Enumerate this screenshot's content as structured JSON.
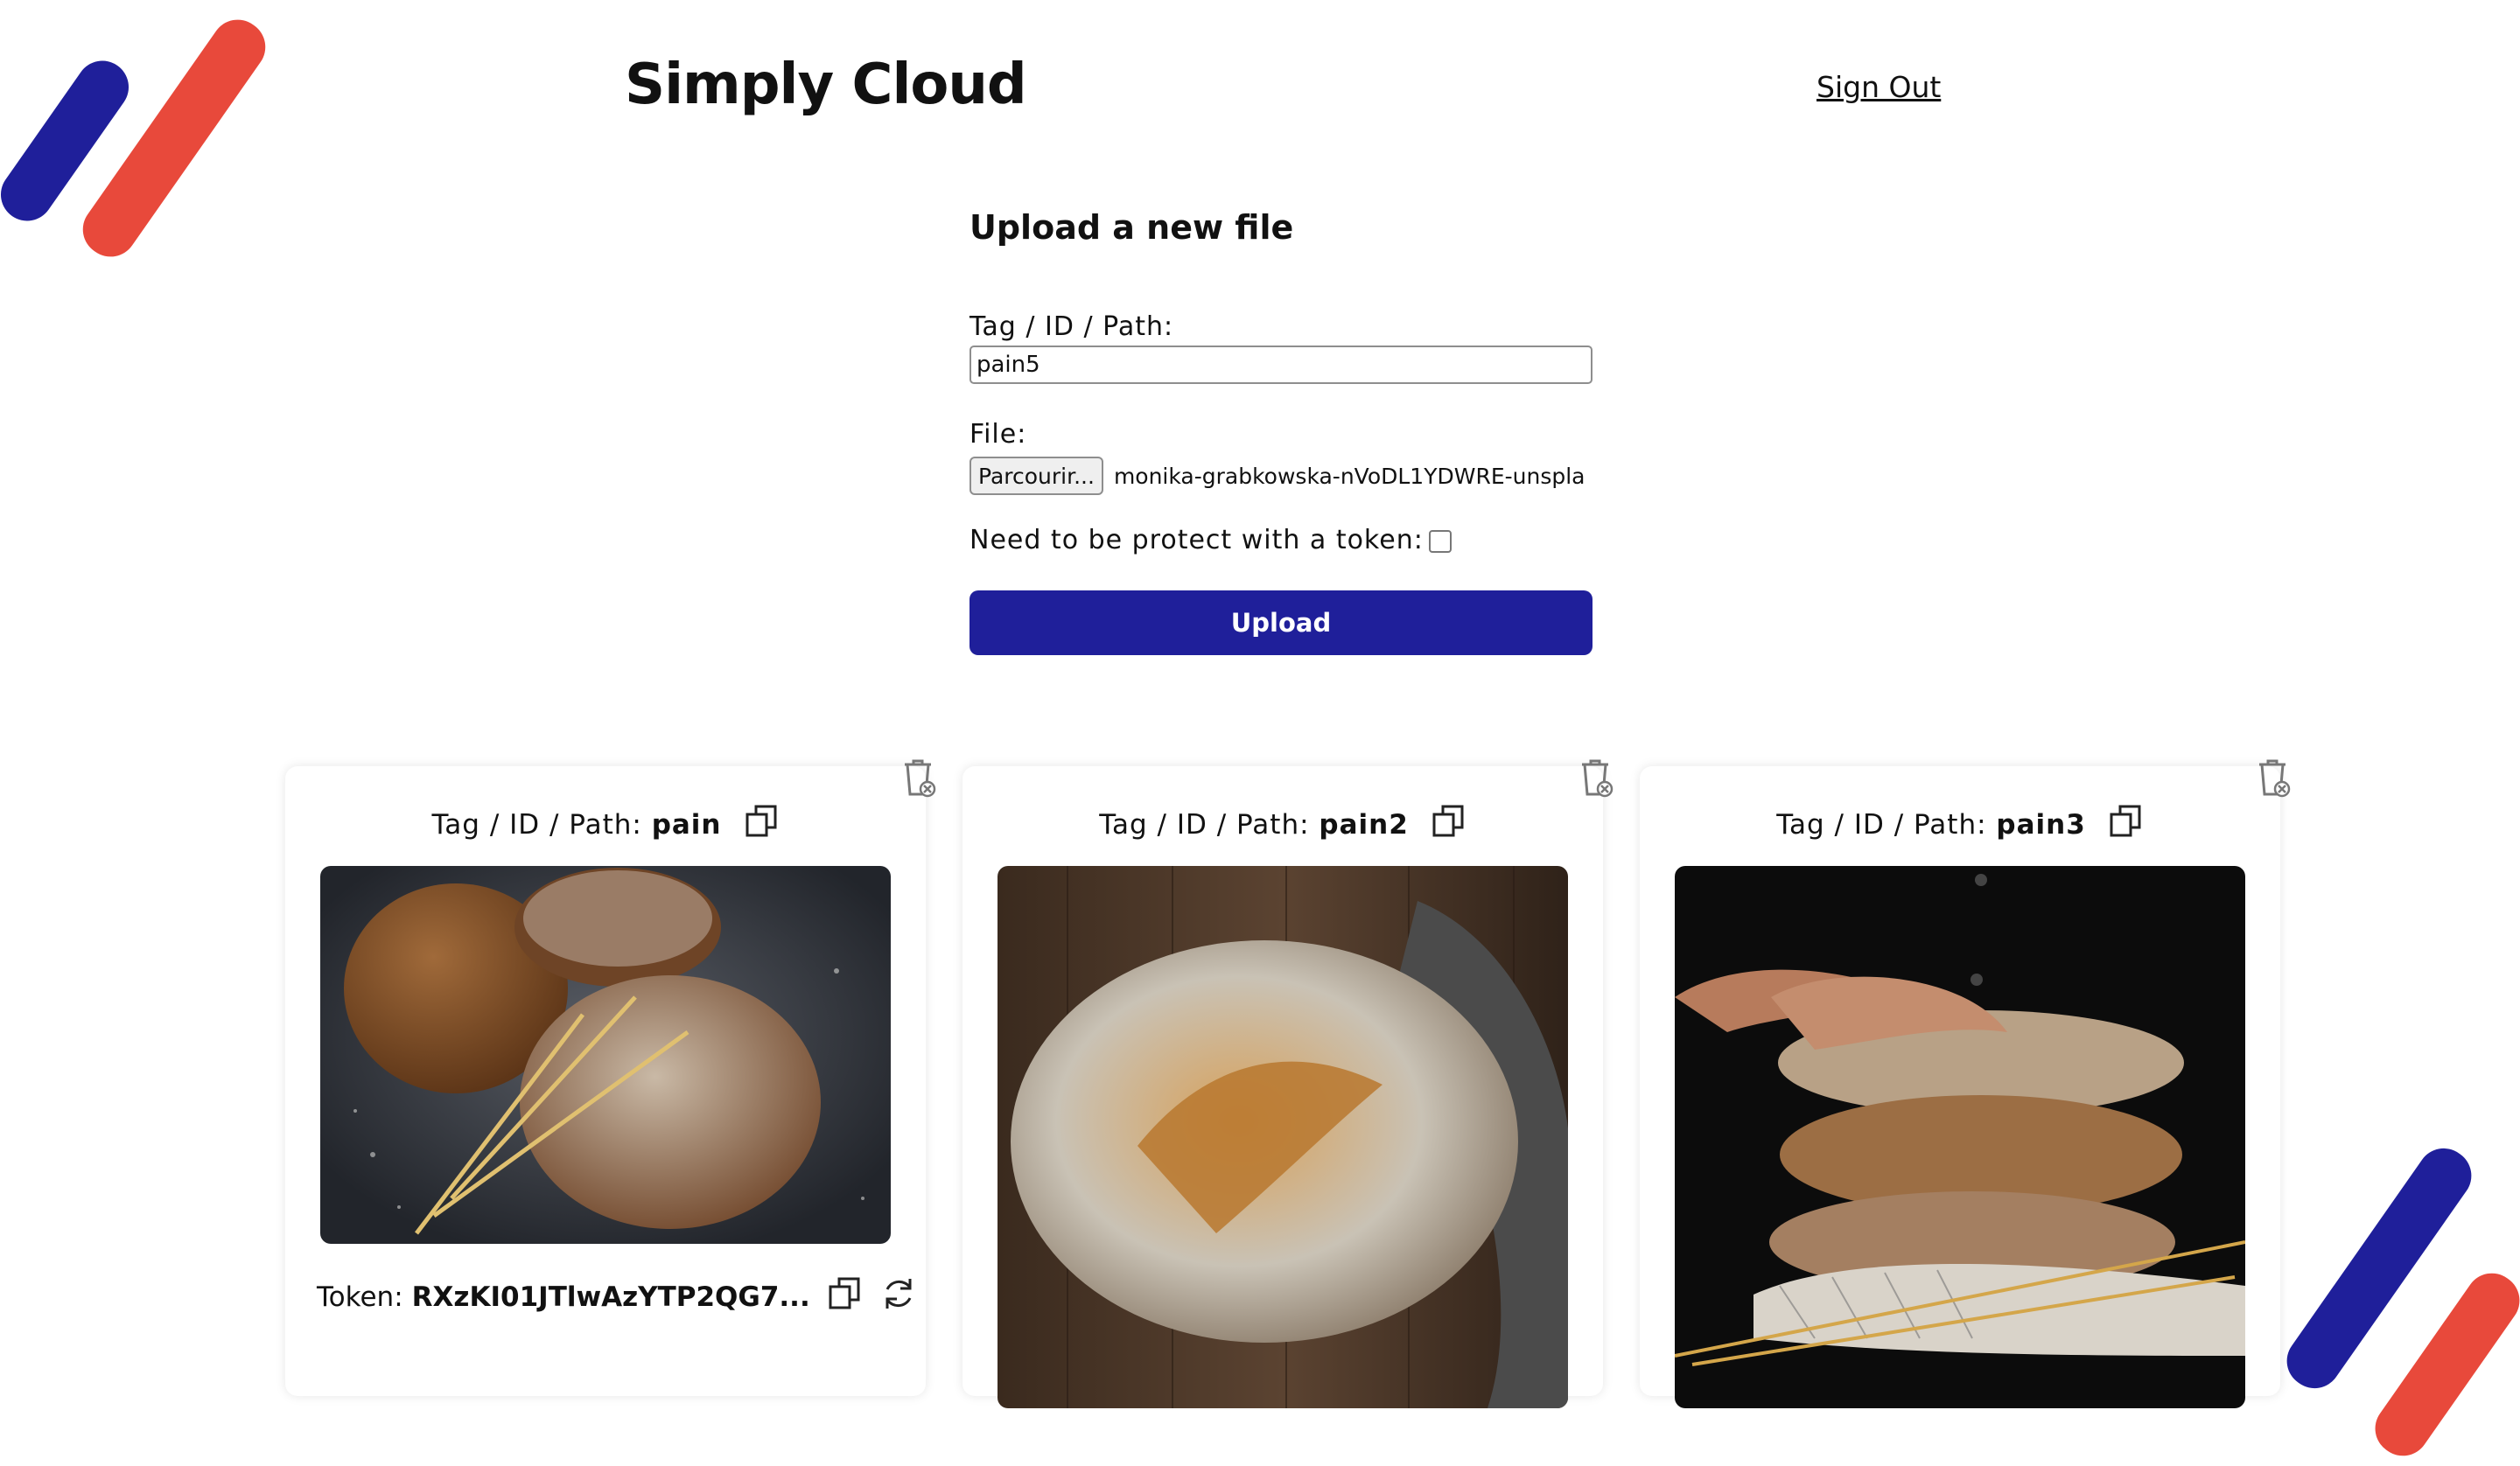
{
  "app": {
    "title": "Simply Cloud",
    "sign_out": "Sign Out"
  },
  "colors": {
    "primary": "#1f1f9a",
    "accent": "#e8493b"
  },
  "upload": {
    "heading": "Upload a new file",
    "path_label": "Tag / ID / Path:",
    "path_value": "pain5",
    "file_label": "File:",
    "browse_label": "Parcourir...",
    "file_name": "monika-grabkowska-nVoDL1YDWRE-unspla",
    "protect_label": "Need to be protect with a token:",
    "protect_checked": false,
    "submit_label": "Upload"
  },
  "files": [
    {
      "label": "Tag / ID / Path:",
      "path": "pain",
      "token_label": "Token:",
      "token": "RXzKI01JTlwAzYTP2QG7...",
      "image": "bread-loaves-with-wheat-photo"
    },
    {
      "label": "Tag / ID / Path:",
      "path": "pain2",
      "image": "rustic-bread-loaf-photo"
    },
    {
      "label": "Tag / ID / Path:",
      "path": "pain3",
      "image": "stacked-bread-loaves-photo"
    }
  ],
  "icons": [
    "copy-icon",
    "trash-icon",
    "refresh-icon"
  ]
}
